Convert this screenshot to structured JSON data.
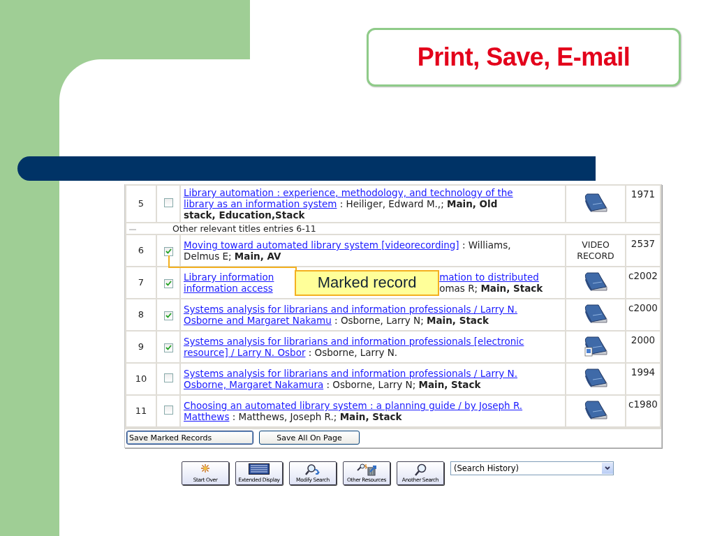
{
  "slide_title": "Print, Save, E-mail",
  "results": {
    "rows": [
      {
        "kind": "record",
        "number": "5",
        "checked": false,
        "lines": [
          [
            {
              "kind": "link",
              "text": "Library automation : experience, methodology, and technology of the"
            }
          ],
          [
            {
              "kind": "link",
              "text": "library as an information system"
            },
            {
              "kind": "text",
              "text": " : Heiliger, Edward M.,; **Main, Old**"
            }
          ],
          [
            {
              "kind": "text",
              "text": "**stack, Education,Stack**"
            }
          ]
        ],
        "format": {
          "kind": "book"
        },
        "year": "1971"
      },
      {
        "kind": "group",
        "label": "Other relevant titles entries 6-11"
      },
      {
        "kind": "record",
        "number": "6",
        "checked": true,
        "lines": [
          [
            {
              "kind": "link",
              "text": "Moving toward automated library system [videorecording]"
            },
            {
              "kind": "text",
              "text": " : Williams,"
            }
          ],
          [
            {
              "kind": "text",
              "text": "Delmus E; **Main, AV**"
            }
          ]
        ],
        "format": {
          "kind": "text",
          "text": "VIDEO RECORD"
        },
        "year": "2537"
      },
      {
        "kind": "record",
        "number": "7",
        "checked": true,
        "callout": "Marked record",
        "lines": [
          [
            {
              "kind": "link",
              "text": "Library information"
            },
            {
              "kind": "gap"
            },
            {
              "kind": "link",
              "text": "mation to distributed"
            }
          ],
          [
            {
              "kind": "link",
              "text": "information access"
            },
            {
              "kind": "gap"
            },
            {
              "kind": "text",
              "text": "omas R; **Main, Stack**"
            }
          ]
        ],
        "format": {
          "kind": "book"
        },
        "year": "c2002"
      },
      {
        "kind": "record",
        "number": "8",
        "checked": true,
        "lines": [
          [
            {
              "kind": "link",
              "text": "Systems analysis for librarians and information professionals / Larry N."
            }
          ],
          [
            {
              "kind": "link",
              "text": "Osborne and Margaret Nakamu"
            },
            {
              "kind": "text",
              "text": " : Osborne, Larry N; **Main, Stack**"
            }
          ]
        ],
        "format": {
          "kind": "book"
        },
        "year": "c2000"
      },
      {
        "kind": "record",
        "number": "9",
        "checked": true,
        "lines": [
          [
            {
              "kind": "link",
              "text": "Systems analysis for librarians and information professionals [electronic"
            }
          ],
          [
            {
              "kind": "link",
              "text": "resource] / Larry N. Osbor"
            },
            {
              "kind": "text",
              "text": " : Osborne, Larry N."
            }
          ]
        ],
        "format": {
          "kind": "ebook"
        },
        "year": "2000"
      },
      {
        "kind": "record",
        "number": "10",
        "checked": false,
        "lines": [
          [
            {
              "kind": "link",
              "text": "Systems analysis for librarians and information professionals / Larry N."
            }
          ],
          [
            {
              "kind": "link",
              "text": "Osborne, Margaret Nakamura"
            },
            {
              "kind": "text",
              "text": " : Osborne, Larry N; **Main, Stack**"
            }
          ]
        ],
        "format": {
          "kind": "book"
        },
        "year": "1994"
      },
      {
        "kind": "record",
        "number": "11",
        "checked": false,
        "lines": [
          [
            {
              "kind": "link",
              "text": "Choosing an automated library system : a planning guide / by Joseph R."
            }
          ],
          [
            {
              "kind": "link",
              "text": "Matthews"
            },
            {
              "kind": "text",
              "text": " : Matthews, Joseph R.; **Main, Stack**"
            }
          ]
        ],
        "format": {
          "kind": "book"
        },
        "year": "c1980"
      }
    ],
    "buttons": [
      {
        "label": "Save Marked Records",
        "focused": true
      },
      {
        "label": "Save All On Page",
        "focused": false
      }
    ]
  },
  "toolbar": [
    {
      "kind": "start",
      "label": "Start Over"
    },
    {
      "kind": "display",
      "label": "Extended Display"
    },
    {
      "kind": "modify",
      "label": "Modify Search"
    },
    {
      "kind": "resources",
      "label": "Other Resources"
    },
    {
      "kind": "search",
      "label": "Another Search"
    }
  ],
  "history_select": {
    "value": "(Search History)"
  }
}
